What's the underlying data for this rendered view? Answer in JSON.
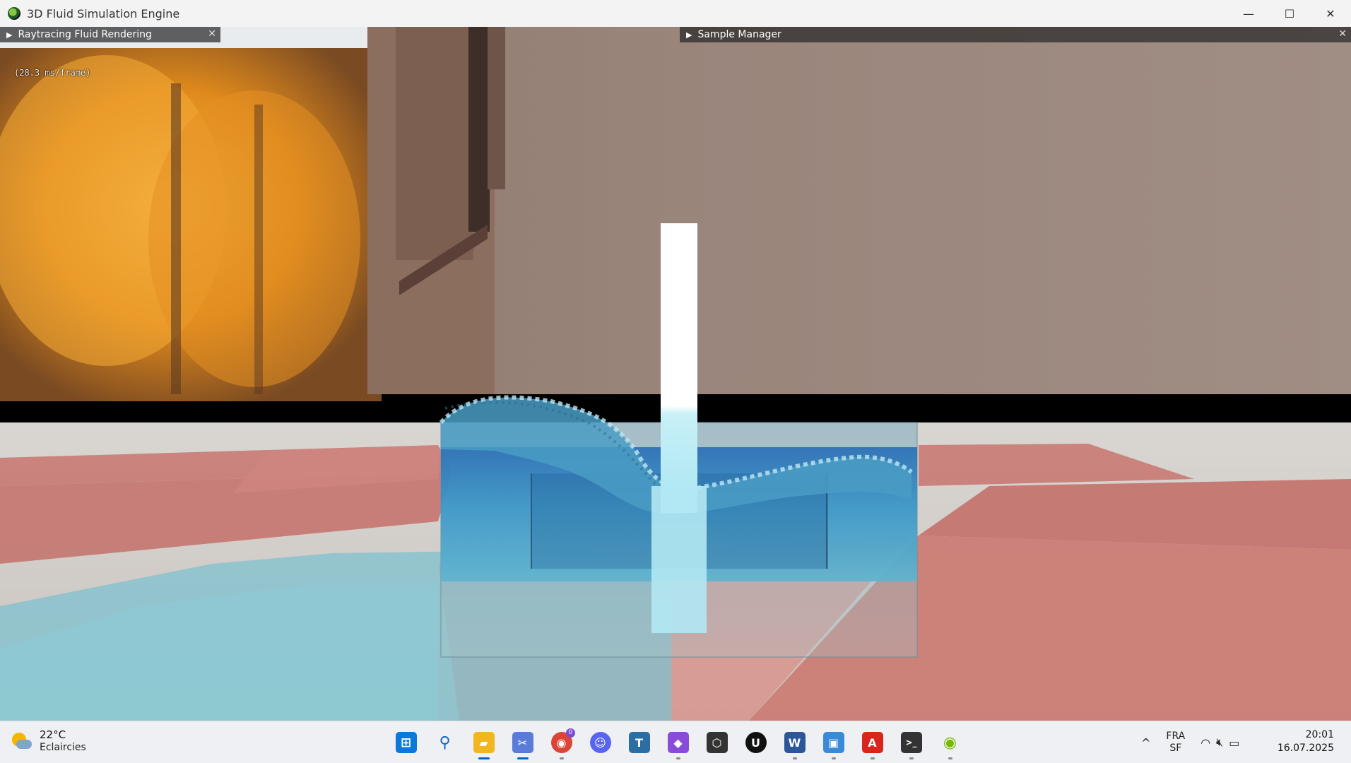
{
  "window": {
    "title": "3D Fluid Simulation Engine",
    "app_icon": "nvidia-icon",
    "controls": {
      "minimize": "—",
      "maximize": "☐",
      "close": "✕"
    }
  },
  "panels": {
    "left": {
      "label": "Raytracing Fluid Rendering",
      "close": "✕",
      "stats": "(28.3 ms/frame)"
    },
    "right": {
      "label": "Sample Manager",
      "close": "✕"
    }
  },
  "taskbar": {
    "weather": {
      "temp": "22°C",
      "condition": "Eclaircies",
      "icon": "partly-sunny-icon"
    },
    "apps": [
      {
        "name": "start",
        "glyph": "⊞",
        "color": "#0a79d8"
      },
      {
        "name": "search",
        "glyph": "⚲",
        "color": "#1565c0"
      },
      {
        "name": "file-explorer",
        "glyph": "▰",
        "color": "#f2b71f"
      },
      {
        "name": "snipping-tool",
        "glyph": "✂",
        "color": "#5a7bd8"
      },
      {
        "name": "chrome",
        "glyph": "◉",
        "color": "#db4437"
      },
      {
        "name": "discord",
        "glyph": "☺",
        "color": "#5865f2"
      },
      {
        "name": "typora",
        "glyph": "T",
        "color": "#2b6ea3"
      },
      {
        "name": "visual-studio",
        "glyph": "◆",
        "color": "#8a4bd8"
      },
      {
        "name": "unity",
        "glyph": "⬡",
        "color": "#333333"
      },
      {
        "name": "unreal-engine",
        "glyph": "U",
        "color": "#111111"
      },
      {
        "name": "word",
        "glyph": "W",
        "color": "#2b579a"
      },
      {
        "name": "window-app",
        "glyph": "▣",
        "color": "#3a8ad8"
      },
      {
        "name": "acrobat",
        "glyph": "A",
        "color": "#d9261c"
      },
      {
        "name": "terminal",
        "glyph": ">_",
        "color": "#333333"
      },
      {
        "name": "nvidia",
        "glyph": "◉",
        "color": "#76b900"
      }
    ],
    "chrome_badge": "0",
    "tray": {
      "chevron": "^",
      "lang_line1": "FRA",
      "lang_line2": "SF",
      "wifi": "wifi-icon",
      "volume": "mute-icon",
      "battery": "battery-icon"
    },
    "clock": {
      "time": "20:01",
      "date": "16.07.2025"
    }
  }
}
